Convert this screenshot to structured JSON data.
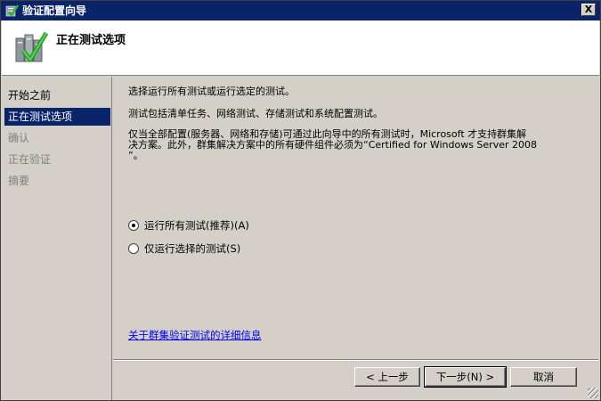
{
  "window": {
    "title": "验证配置向导",
    "close_label": "X"
  },
  "header": {
    "title": "正在测试选项",
    "icon": "wizard-checkmark-icon"
  },
  "nav": {
    "items": [
      {
        "label": "开始之前",
        "state": "normal"
      },
      {
        "label": "正在测试选项",
        "state": "active"
      },
      {
        "label": "确认",
        "state": "disabled"
      },
      {
        "label": "正在验证",
        "state": "disabled"
      },
      {
        "label": "摘要",
        "state": "disabled"
      }
    ]
  },
  "content": {
    "para1": "选择运行所有测试或运行选定的测试。",
    "para2": "测试包括清单任务、网络测试、存储测试和系统配置测试。",
    "para3_line1": "仅当全部配置(服务器、网络和存储)可通过此向导中的所有测试时，Microsoft 才支持群集解",
    "para3_line2": "决方案。此外，群集解决方案中的所有硬件组件必须为“Certified for Windows Server 2008",
    "para3_line3": "”。",
    "radio_all": {
      "label": "运行所有测试(推荐)(A)",
      "checked": true
    },
    "radio_selected": {
      "label": "仅运行选择的测试(S)",
      "checked": false
    },
    "link": "关于群集验证测试的详细信息"
  },
  "buttons": {
    "back": "< 上一步",
    "next": "下一步(N) >",
    "cancel": "取消"
  },
  "colors": {
    "titlebar": "#0a246a",
    "face": "#d4d0c8",
    "link": "#0000ee"
  }
}
